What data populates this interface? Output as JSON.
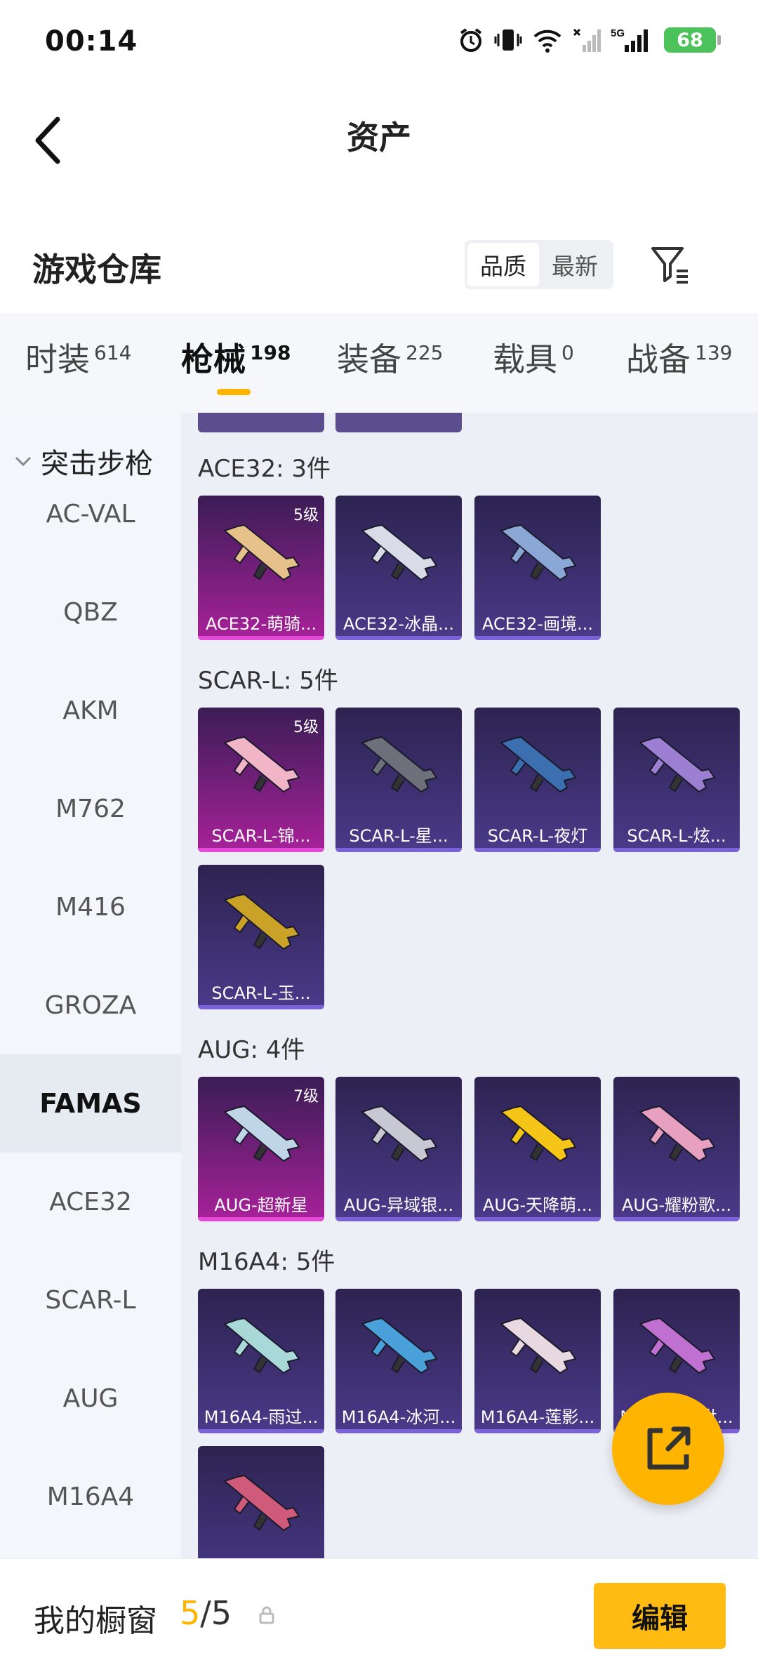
{
  "status": {
    "time": "00:14",
    "battery": "68"
  },
  "header": {
    "title": "资产"
  },
  "warehouse": {
    "title": "游戏仓库",
    "sort_quality": "品质",
    "sort_newest": "最新"
  },
  "tabs": [
    {
      "label": "时装",
      "count": "614"
    },
    {
      "label": "枪械",
      "count": "198"
    },
    {
      "label": "装备",
      "count": "225"
    },
    {
      "label": "载具",
      "count": "0"
    },
    {
      "label": "战备",
      "count": "139"
    }
  ],
  "sidebar": {
    "group": "突击步枪",
    "items": [
      "AC-VAL",
      "QBZ",
      "AKM",
      "M762",
      "M416",
      "GROZA",
      "FAMAS",
      "ACE32",
      "SCAR-L",
      "AUG",
      "M16A4"
    ]
  },
  "sections": [
    {
      "title": "ACE32: 3件",
      "items": [
        {
          "name": "ACE32-萌骑...",
          "level": "5级",
          "style": "pink"
        },
        {
          "name": "ACE32-冰晶...",
          "level": "",
          "style": "purple"
        },
        {
          "name": "ACE32-画境...",
          "level": "",
          "style": "purple"
        }
      ]
    },
    {
      "title": "SCAR-L: 5件",
      "items": [
        {
          "name": "SCAR-L-锦...",
          "level": "5级",
          "style": "pink"
        },
        {
          "name": "SCAR-L-星...",
          "level": "",
          "style": "purple"
        },
        {
          "name": "SCAR-L-夜灯",
          "level": "",
          "style": "purple"
        },
        {
          "name": "SCAR-L-炫...",
          "level": "",
          "style": "purple"
        },
        {
          "name": "SCAR-L-玉...",
          "level": "",
          "style": "purple"
        }
      ]
    },
    {
      "title": "AUG: 4件",
      "items": [
        {
          "name": "AUG-超新星",
          "level": "7级",
          "style": "pink"
        },
        {
          "name": "AUG-异域银...",
          "level": "",
          "style": "purple"
        },
        {
          "name": "AUG-天降萌...",
          "level": "",
          "style": "purple"
        },
        {
          "name": "AUG-耀粉歌...",
          "level": "",
          "style": "purple"
        }
      ]
    },
    {
      "title": "M16A4: 5件",
      "items": [
        {
          "name": "M16A4-雨过...",
          "level": "",
          "style": "purple"
        },
        {
          "name": "M16A4-冰河...",
          "level": "",
          "style": "purple"
        },
        {
          "name": "M16A4-莲影...",
          "level": "",
          "style": "purple"
        },
        {
          "name": "M16A4-...世...",
          "level": "",
          "style": "purple"
        },
        {
          "name": "",
          "level": "",
          "style": "purple"
        }
      ]
    }
  ],
  "bottom": {
    "label": "我的橱窗",
    "current": "5",
    "total": "/5",
    "edit": "编辑"
  },
  "colors": {
    "accent": "#ffb400",
    "card_purple": "#4a3a8a",
    "card_pink": "#a8219a"
  }
}
